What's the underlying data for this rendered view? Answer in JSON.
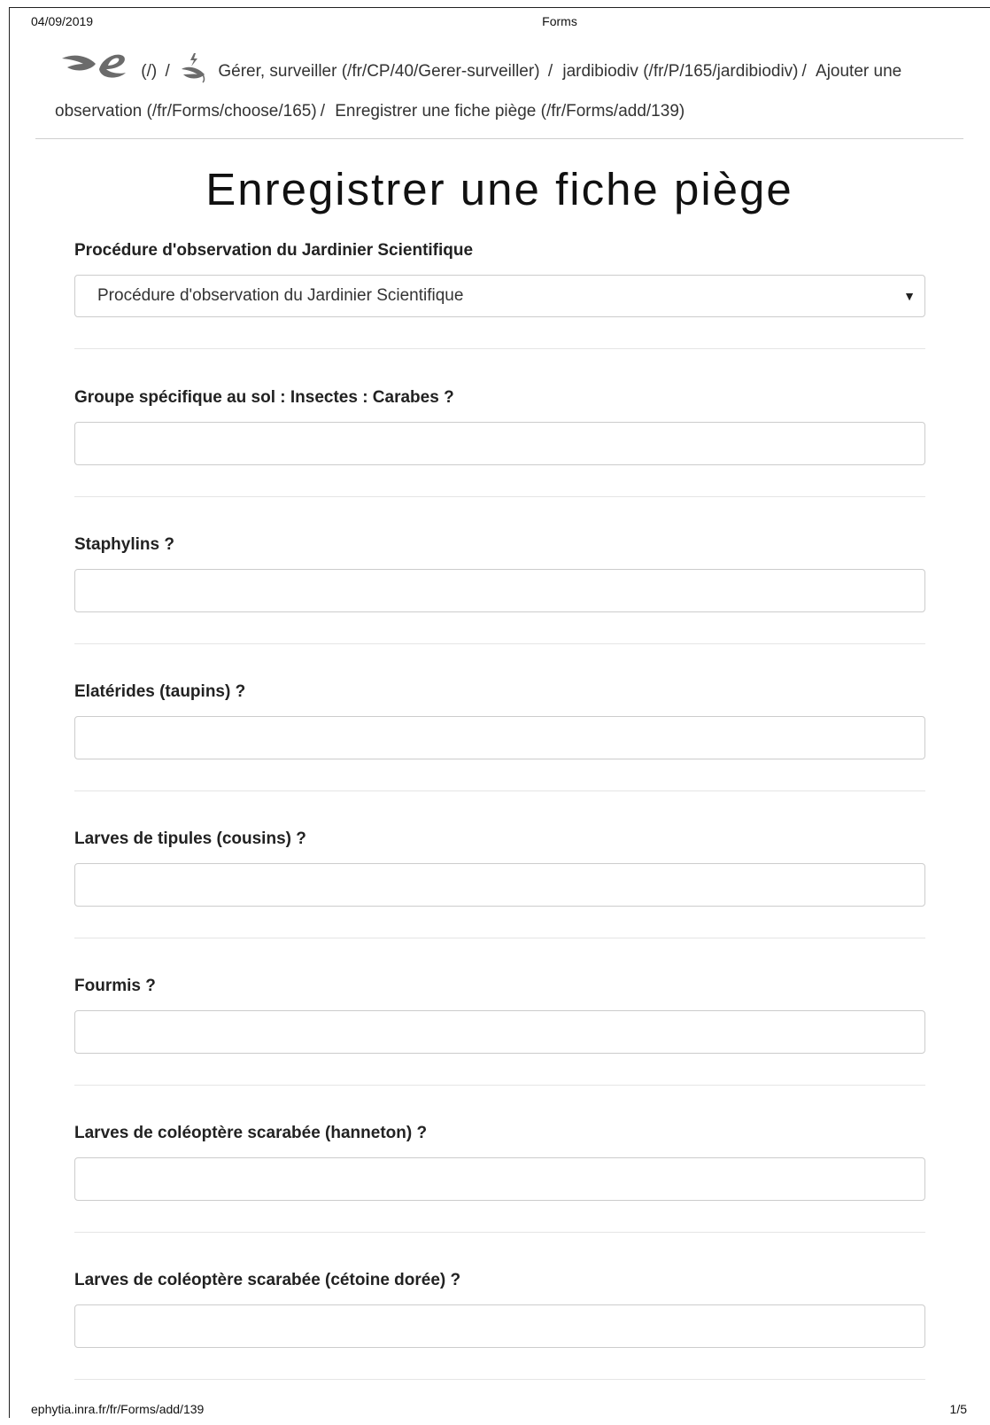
{
  "print_header": {
    "date": "04/09/2019",
    "title": "Forms"
  },
  "breadcrumb": {
    "items": [
      {
        "label": "(/)",
        "icon": "ephytia-logo-icon"
      },
      {
        "label": "Gérer, surveiller (/fr/CP/40/Gerer-surveiller)",
        "icon": "leaf-lightning-icon"
      },
      {
        "label": "jardibiodiv (/fr/P/165/jardibiodiv)"
      },
      {
        "label": "Ajouter une observation (/fr/Forms/choose/165)"
      },
      {
        "label": "Enregistrer une fiche piège (/fr/Forms/add/139)"
      }
    ],
    "separator": "/"
  },
  "page_title": "Enregistrer une fiche piège",
  "form": {
    "procedure": {
      "label": "Procédure d'observation du Jardinier Scientifique",
      "selected": "Procédure d'observation du Jardinier Scientifique",
      "arrow": "▼"
    },
    "fields": [
      {
        "label": "Groupe spécifique au sol : Insectes : Carabes ?",
        "value": ""
      },
      {
        "label": "Staphylins ?",
        "value": ""
      },
      {
        "label": "Elatérides (taupins) ?",
        "value": ""
      },
      {
        "label": "Larves de tipules (cousins) ?",
        "value": ""
      },
      {
        "label": "Fourmis ?",
        "value": ""
      },
      {
        "label": "Larves de coléoptère scarabée (hanneton) ?",
        "value": ""
      },
      {
        "label": "Larves de coléoptère scarabée (cétoine dorée) ?",
        "value": ""
      }
    ]
  },
  "print_footer": {
    "url": "ephytia.inra.fr/fr/Forms/add/139",
    "page": "1/5"
  },
  "colors": {
    "border": "#cccccc",
    "rule": "#e5e5e5",
    "logo": "#6b6b6b"
  }
}
